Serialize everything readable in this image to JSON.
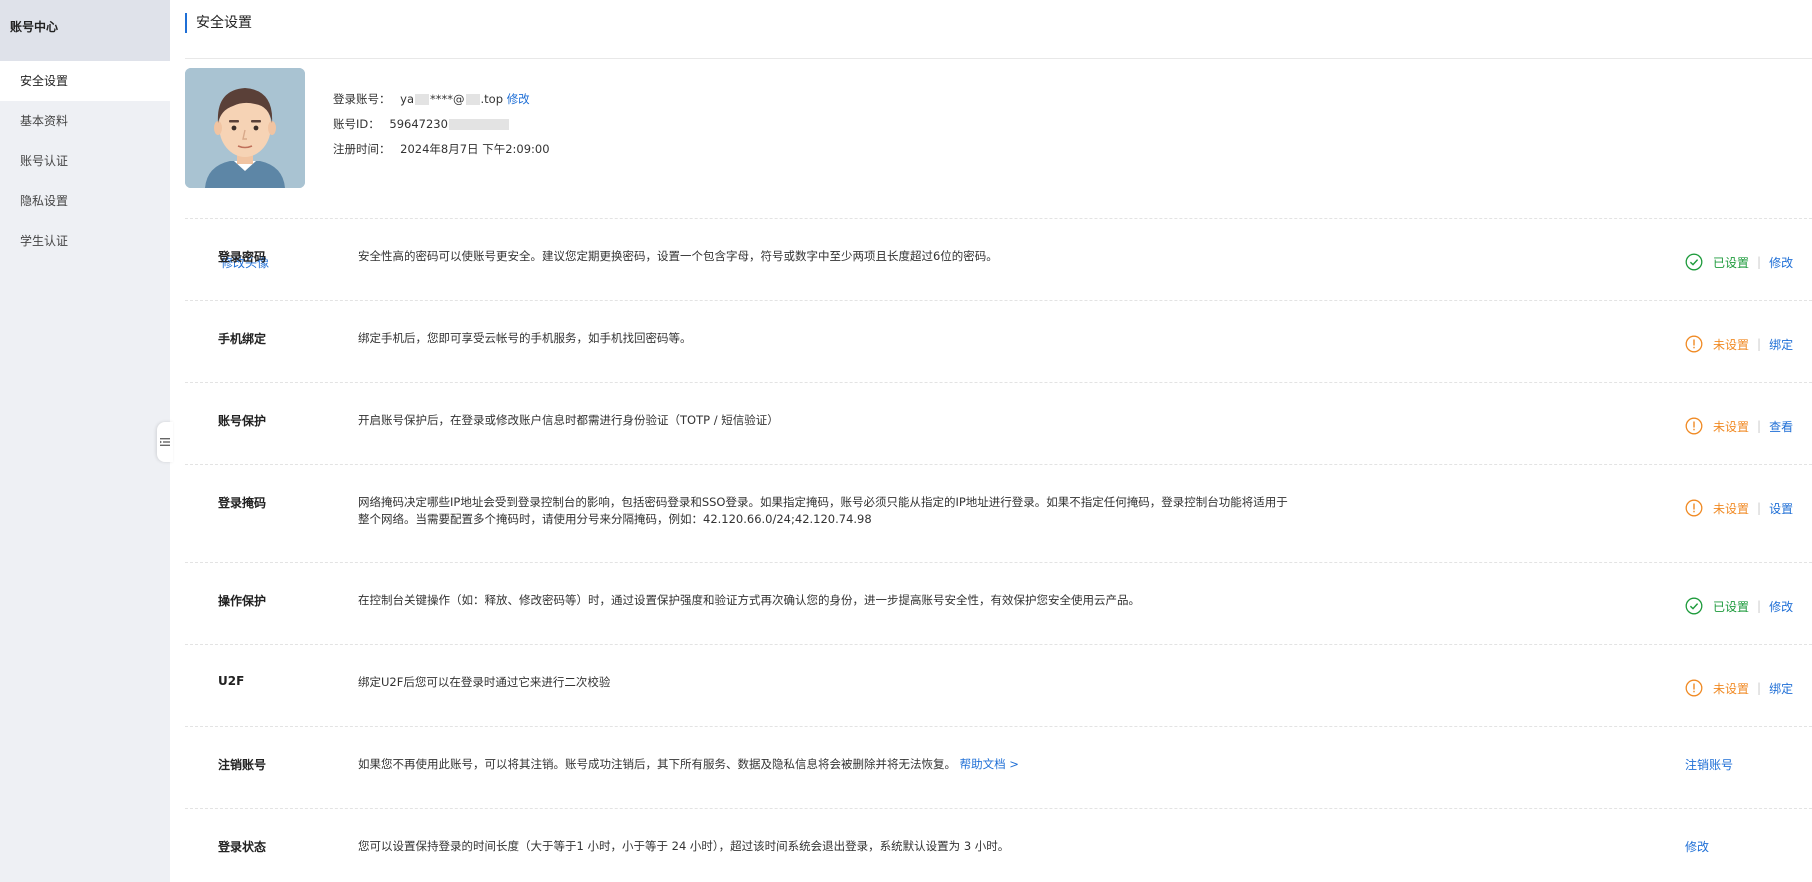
{
  "sidebar": {
    "title": "账号中心",
    "items": [
      {
        "label": "安全设置"
      },
      {
        "label": "基本资料"
      },
      {
        "label": "账号认证"
      },
      {
        "label": "隐私设置"
      },
      {
        "label": "学生认证"
      }
    ]
  },
  "page": {
    "title": "安全设置"
  },
  "profile": {
    "change_avatar": "修改头像",
    "login_account_label": "登录账号：",
    "login_account_prefix": "ya",
    "login_account_middle": "****@",
    "login_account_suffix": ".top",
    "login_account_action": "修改",
    "account_id_label": "账号ID：",
    "account_id_value": "59647230",
    "register_time_label": "注册时间：",
    "register_time_value": "2024年8月7日 下午2:09:00"
  },
  "settings": [
    {
      "name": "登录密码",
      "desc": "安全性高的密码可以使账号更安全。建议您定期更换密码，设置一个包含字母，符号或数字中至少两项且长度超过6位的密码。",
      "status": "已设置",
      "action": "修改",
      "state": "ok"
    },
    {
      "name": "手机绑定",
      "desc": "绑定手机后，您即可享受云帐号的手机服务，如手机找回密码等。",
      "status": "未设置",
      "action": "绑定",
      "state": "warn"
    },
    {
      "name": "账号保护",
      "desc": "开启账号保护后，在登录或修改账户信息时都需进行身份验证（TOTP / 短信验证）",
      "status": "未设置",
      "action": "查看",
      "state": "warn"
    },
    {
      "name": "登录掩码",
      "desc_line1": "网络掩码决定哪些IP地址会受到登录控制台的影响，包括密码登录和SSO登录。如果指定掩码，账号必须只能从指定的IP地址进行登录。如果不指定任何掩码，登录控制台功能将适用于",
      "desc_line2": "整个网络。当需要配置多个掩码时，请使用分号来分隔掩码，例如：42.120.66.0/24;42.120.74.98",
      "status": "未设置",
      "action": "设置",
      "state": "warn"
    },
    {
      "name": "操作保护",
      "desc": "在控制台关键操作（如：释放、修改密码等）时，通过设置保护强度和验证方式再次确认您的身份，进一步提高账号安全性，有效保护您安全使用云产品。",
      "status": "已设置",
      "action": "修改",
      "state": "ok"
    },
    {
      "name": "U2F",
      "desc": "绑定U2F后您可以在登录时通过它来进行二次校验",
      "status": "未设置",
      "action": "绑定",
      "state": "warn"
    },
    {
      "name": "注销账号",
      "desc": "如果您不再使用此账号，可以将其注销。账号成功注销后，其下所有服务、数据及隐私信息将会被删除并将无法恢复。",
      "help_link": "帮助文档 >",
      "action": "注销账号"
    },
    {
      "name": "登录状态",
      "desc": "您可以设置保持登录的时间长度（大于等于1 小时，小于等于 24 小时），超过该时间系统会退出登录，系统默认设置为 3 小时。",
      "action": "修改"
    }
  ],
  "colors": {
    "accent": "#1f6fd6",
    "ok": "#1e9b3c",
    "warn": "#f08a24"
  }
}
